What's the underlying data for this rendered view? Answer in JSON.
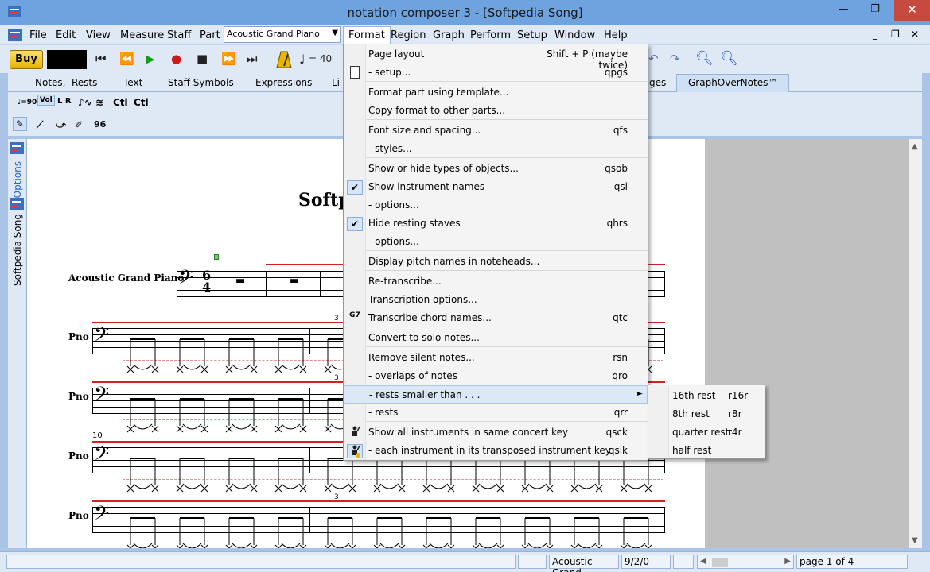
{
  "window": {
    "title": "notation composer 3 - [Softpedia Song]",
    "minimize": "—",
    "restore": "❐",
    "close": "✕"
  },
  "menu": {
    "items": [
      "File",
      "Edit",
      "View",
      "Measure",
      "Staff",
      "Part",
      "Format",
      "Region",
      "Graph",
      "Perform",
      "Setup",
      "Window",
      "Help"
    ],
    "part_select": "Acoustic Grand Piano",
    "mdi": {
      "minimize": "_",
      "restore": "❐",
      "close": "✕"
    }
  },
  "toolbar": {
    "buy": "Buy",
    "tempo_eq": "= 40"
  },
  "tabs": [
    "Notes,",
    "Rests",
    "Text",
    "Staff Symbols",
    "Expressions",
    "Li",
    "ges",
    "GraphOverNotes™"
  ],
  "row3": {
    "ctl1": "Ctl",
    "ctl2": "Ctl"
  },
  "row4": {
    "value": "96"
  },
  "side": {
    "options": "Options",
    "song": "Softpedia Song"
  },
  "score": {
    "title": "Softp",
    "instrument": "Acoustic Grand Piano",
    "short_name": "Pno",
    "time_sig_top": "6",
    "time_sig_bottom": "4",
    "measure_10": "10",
    "triplet": "3"
  },
  "format_menu": {
    "items": [
      {
        "label": "Page layout",
        "shortcut": "Shift + P  (maybe twice)"
      },
      {
        "label": "-        setup...",
        "shortcut": "qpgs"
      },
      {
        "label": "Format part using template...",
        "shortcut": ""
      },
      {
        "label": "Copy format to other parts...",
        "shortcut": ""
      },
      {
        "label": "Font size and spacing...",
        "shortcut": "qfs"
      },
      {
        "label": "-        styles...",
        "shortcut": ""
      },
      {
        "label": "Show or hide types of objects...",
        "shortcut": "qsob"
      },
      {
        "label": "Show instrument names",
        "shortcut": "qsi"
      },
      {
        "label": "-        options...",
        "shortcut": ""
      },
      {
        "label": "Hide resting staves",
        "shortcut": "qhrs"
      },
      {
        "label": "-        options...",
        "shortcut": ""
      },
      {
        "label": "Display pitch names in noteheads...",
        "shortcut": ""
      },
      {
        "label": "Re-transcribe...",
        "shortcut": ""
      },
      {
        "label": "Transcription options...",
        "shortcut": ""
      },
      {
        "label": "Transcribe chord names...",
        "shortcut": "qtc"
      },
      {
        "label": "Convert to solo notes...",
        "shortcut": ""
      },
      {
        "label": "Remove silent notes...",
        "shortcut": "rsn"
      },
      {
        "label": "-        overlaps of notes",
        "shortcut": "qro"
      },
      {
        "label": "-        rests smaller than . . .",
        "shortcut": ""
      },
      {
        "label": "-        rests",
        "shortcut": "qrr"
      },
      {
        "label": "Show all instruments in same concert key",
        "shortcut": "qsck"
      },
      {
        "label": "-        each instrument in its transposed instrument key",
        "shortcut": "qsik"
      }
    ],
    "submenu_arrow": "►",
    "check": "✔",
    "chord_icon": "G7"
  },
  "submenu": {
    "items": [
      {
        "label": "16th rest",
        "shortcut": "r16r"
      },
      {
        "label": "8th rest",
        "shortcut": "r8r"
      },
      {
        "label": "quarter rest",
        "shortcut": "r4r"
      },
      {
        "label": "half rest",
        "shortcut": ""
      }
    ]
  },
  "status": {
    "instrument": "Acoustic Grand",
    "position": "9/2/0",
    "page": "page 1 of 4"
  }
}
